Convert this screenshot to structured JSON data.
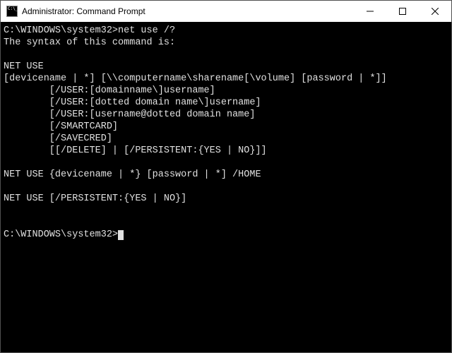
{
  "window": {
    "title": "Administrator: Command Prompt"
  },
  "terminal": {
    "prompt1_path": "C:\\WINDOWS\\system32>",
    "prompt1_cmd": "net use /?",
    "output": "The syntax of this command is:\n\nNET USE\n[devicename | *] [\\\\computername\\sharename[\\volume] [password | *]]\n        [/USER:[domainname\\]username]\n        [/USER:[dotted domain name\\]username]\n        [/USER:[username@dotted domain name]\n        [/SMARTCARD]\n        [/SAVECRED]\n        [[/DELETE] | [/PERSISTENT:{YES | NO}]]\n\nNET USE {devicename | *} [password | *] /HOME\n\nNET USE [/PERSISTENT:{YES | NO}]\n\n",
    "prompt2_path": "C:\\WINDOWS\\system32>"
  }
}
